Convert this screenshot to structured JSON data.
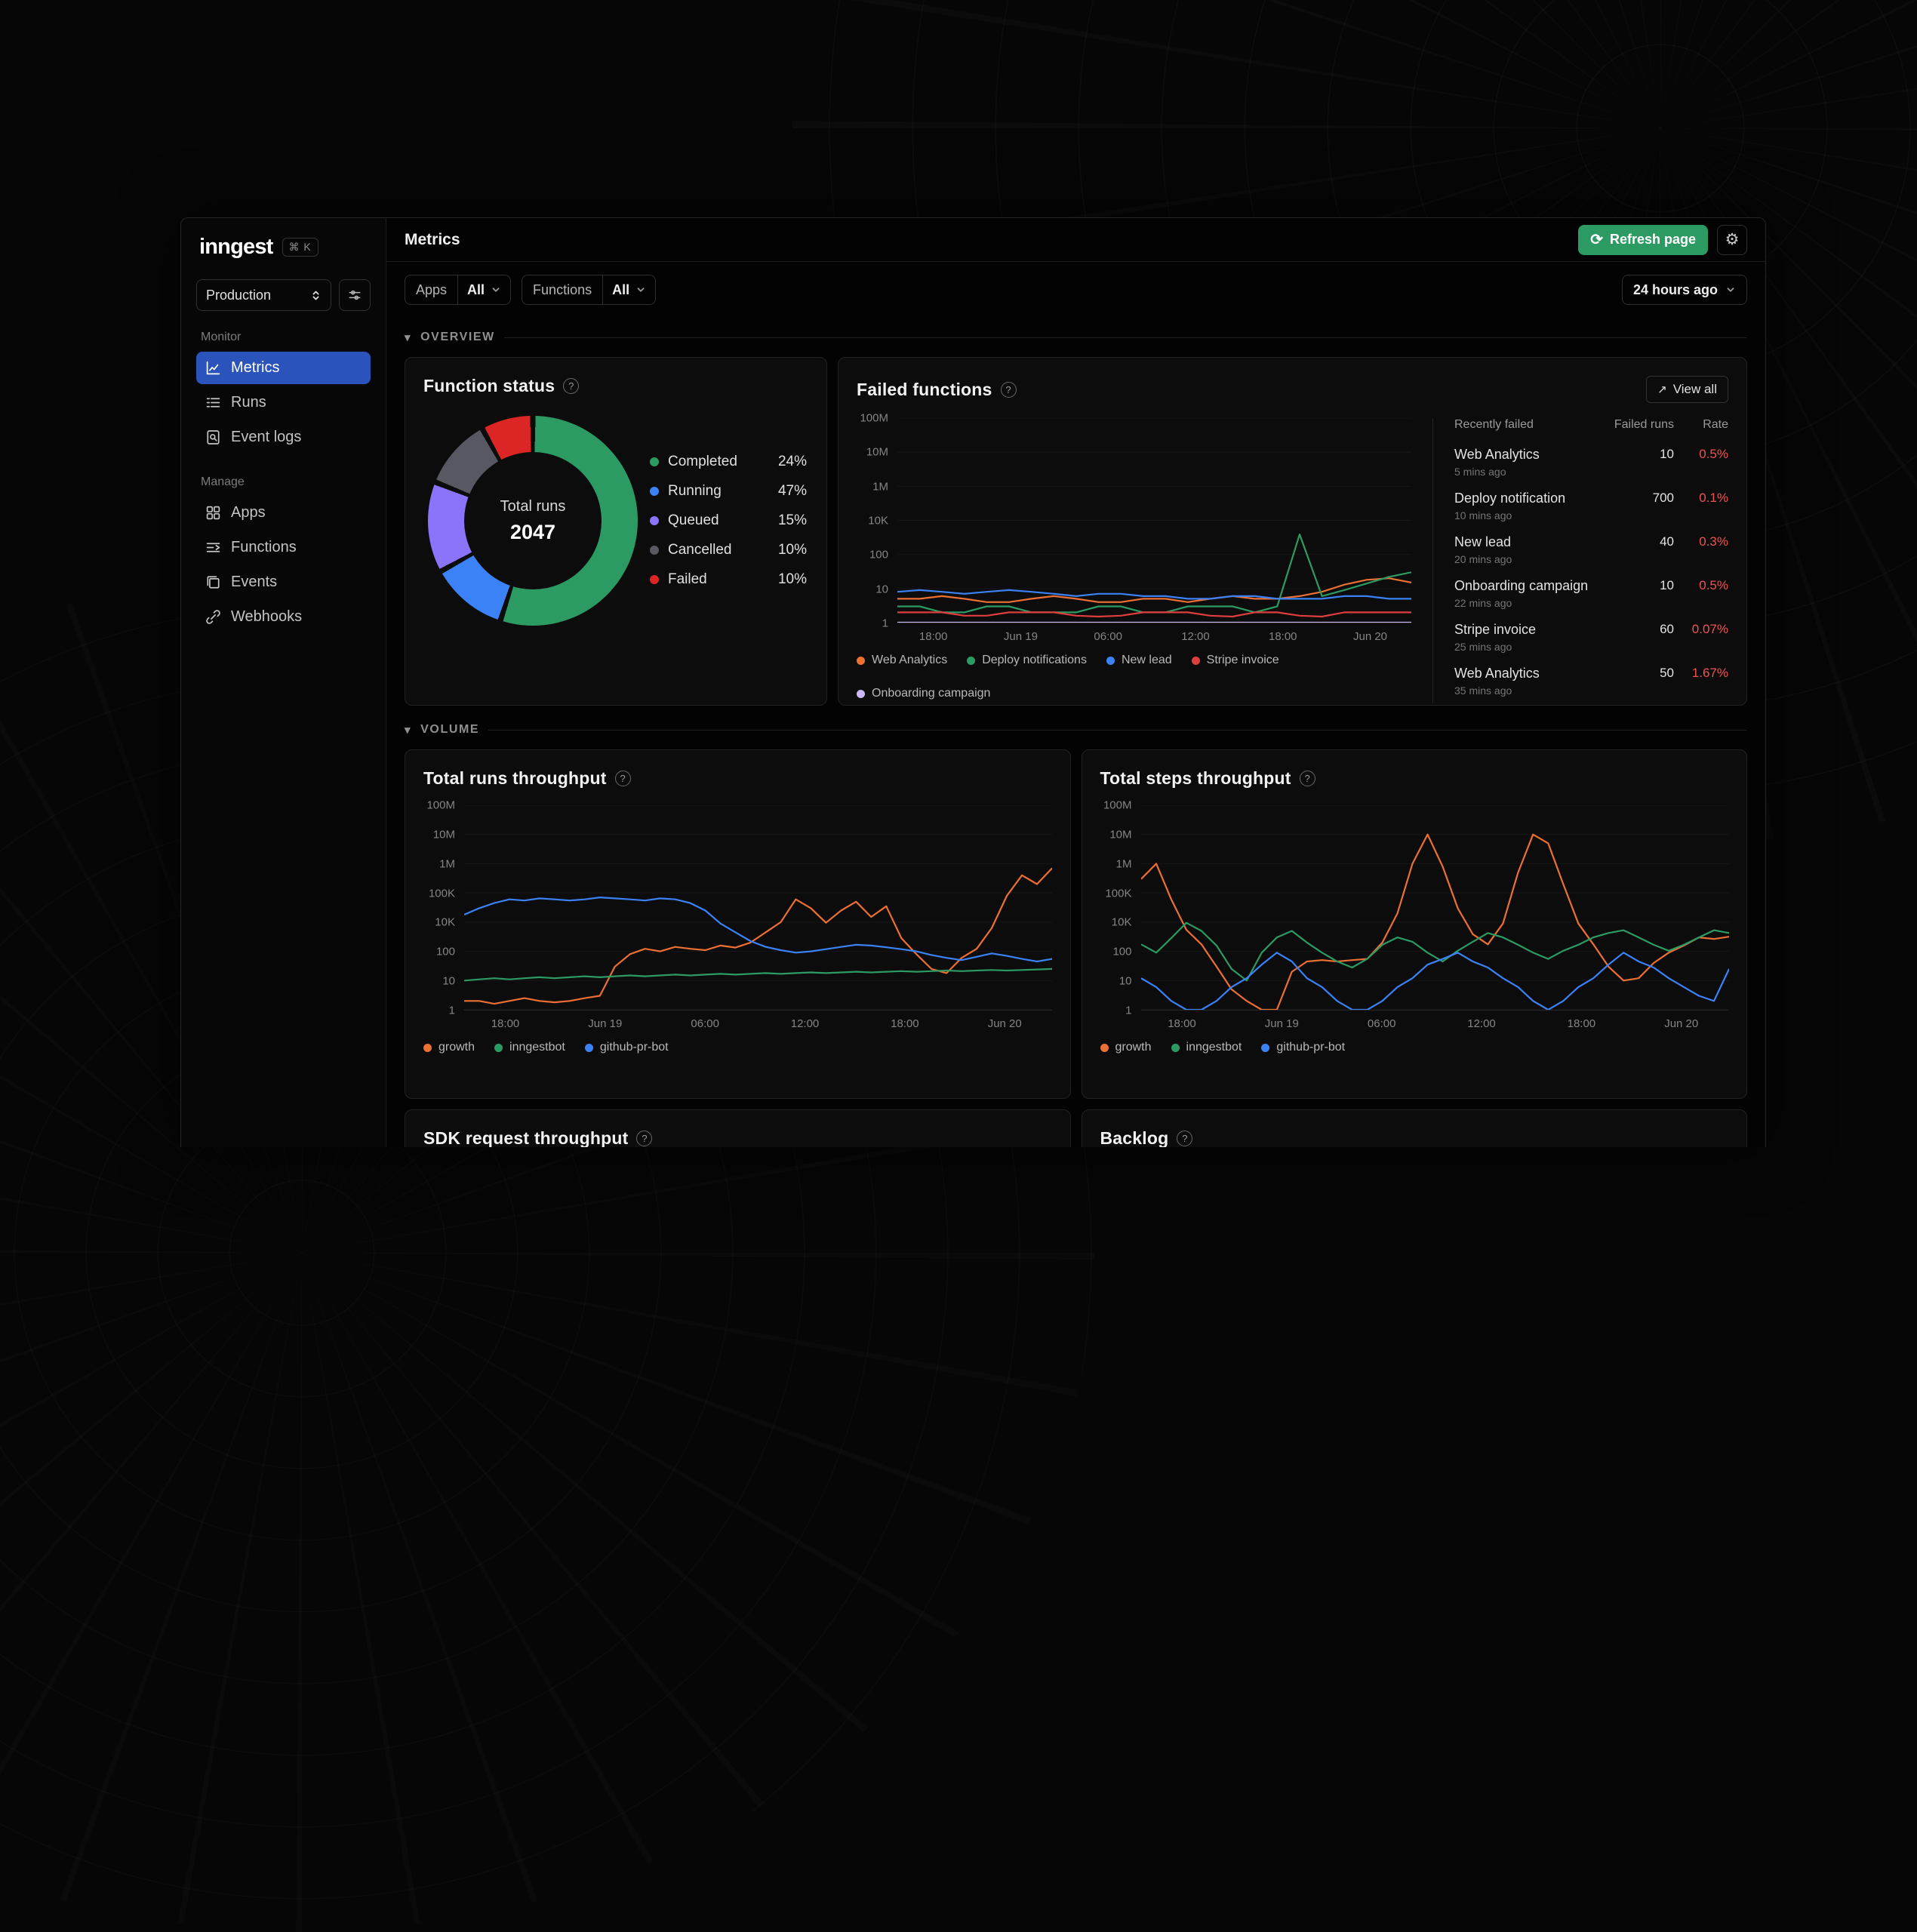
{
  "colors": {
    "brand_green": "#2c9b63",
    "active_nav_blue": "#2a54bb",
    "error_red": "#f05252"
  },
  "sidebar": {
    "logo": "inngest",
    "kbd_shortcut": "⌘ K",
    "env": "Production",
    "monitor_label": "Monitor",
    "manage_label": "Manage",
    "items": {
      "metrics": "Metrics",
      "runs": "Runs",
      "event_logs": "Event logs",
      "apps": "Apps",
      "functions": "Functions",
      "events": "Events",
      "webhooks": "Webhooks"
    }
  },
  "header": {
    "title": "Metrics",
    "refresh_label": "Refresh page"
  },
  "filters": {
    "apps_label": "Apps",
    "apps_value": "All",
    "functions_label": "Functions",
    "functions_value": "All",
    "time_range": "24 hours ago"
  },
  "sections": {
    "overview": "OVERVIEW",
    "volume": "VOLUME"
  },
  "cards": {
    "function_status": {
      "title": "Function status"
    },
    "failed_functions": {
      "title": "Failed functions",
      "view_all": "View all",
      "table": {
        "headers": [
          "Recently failed",
          "Failed runs",
          "Rate"
        ],
        "rows": [
          {
            "name": "Web Analytics",
            "ago": "5 mins ago",
            "runs": "10",
            "rate": "0.5%"
          },
          {
            "name": "Deploy notification",
            "ago": "10 mins ago",
            "runs": "700",
            "rate": "0.1%"
          },
          {
            "name": "New lead",
            "ago": "20 mins ago",
            "runs": "40",
            "rate": "0.3%"
          },
          {
            "name": "Onboarding campaign",
            "ago": "22 mins ago",
            "runs": "10",
            "rate": "0.5%"
          },
          {
            "name": "Stripe invoice",
            "ago": "25 mins ago",
            "runs": "60",
            "rate": "0.07%"
          },
          {
            "name": "Web Analytics",
            "ago": "35 mins ago",
            "runs": "50",
            "rate": "1.67%"
          }
        ]
      }
    },
    "total_runs": {
      "title": "Total runs throughput"
    },
    "total_steps": {
      "title": "Total steps throughput"
    },
    "sdk_requests": {
      "title": "SDK request throughput"
    },
    "backlog": {
      "title": "Backlog"
    }
  },
  "chart_data": [
    {
      "id": "function-status-donut",
      "type": "pie",
      "title": "Function status",
      "center_label": "Total runs",
      "center_value": "2047",
      "slices": [
        {
          "label": "Completed",
          "pct_label": "24%",
          "value_pct": 24,
          "arc_pct": 55,
          "color": "#2c9b63"
        },
        {
          "label": "Running",
          "pct_label": "47%",
          "value_pct": 47,
          "arc_pct": 12,
          "color": "#3b82f6"
        },
        {
          "label": "Queued",
          "pct_label": "15%",
          "value_pct": 15,
          "arc_pct": 14,
          "color": "#8b74f9"
        },
        {
          "label": "Cancelled",
          "pct_label": "10%",
          "value_pct": 10,
          "arc_pct": 11,
          "color": "#585862"
        },
        {
          "label": "Failed",
          "pct_label": "10%",
          "value_pct": 10,
          "arc_pct": 8,
          "color": "#dc2626"
        }
      ]
    },
    {
      "id": "failed-functions-chart",
      "type": "line",
      "title": "Failed functions",
      "y_scale": "log",
      "yticks": [
        1,
        10,
        100,
        10000,
        1000000,
        10000000,
        100000000
      ],
      "ytick_labels": [
        "1",
        "10",
        "100",
        "10K",
        "1M",
        "10M",
        "100M"
      ],
      "xticks": [
        "18:00",
        "Jun 19",
        "06:00",
        "12:00",
        "18:00",
        "Jun 20"
      ],
      "xtick_pos": [
        0.07,
        0.24,
        0.41,
        0.58,
        0.75,
        0.92
      ],
      "legend_position": "bottom",
      "series": [
        {
          "name": "Web Analytics",
          "color": "#ec6f33",
          "values": [
            5,
            5,
            6,
            5,
            4,
            4,
            5,
            6,
            5,
            4,
            4,
            5,
            5,
            4,
            5,
            6,
            5,
            5,
            6,
            8,
            13,
            18,
            20,
            15
          ]
        },
        {
          "name": "Deploy notifications",
          "color": "#2c9b63",
          "values": [
            3,
            3,
            2,
            2,
            3,
            3,
            2,
            2,
            2,
            3,
            3,
            2,
            2,
            3,
            3,
            3,
            2,
            3,
            1500,
            6,
            9,
            14,
            22,
            30
          ]
        },
        {
          "name": "New lead",
          "color": "#3b82f6",
          "values": [
            8,
            9,
            8,
            7,
            8,
            9,
            8,
            7,
            6,
            7,
            7,
            6,
            6,
            5,
            5,
            6,
            6,
            5,
            5,
            5,
            6,
            6,
            5,
            5
          ]
        },
        {
          "name": "Stripe invoice",
          "color": "#e03d3d",
          "values": [
            2,
            2,
            2,
            1.6,
            1.6,
            2,
            2,
            2,
            1.6,
            1.5,
            1.6,
            2,
            2,
            2,
            1.6,
            1.5,
            2,
            2,
            1.6,
            1.5,
            2,
            2,
            2,
            2
          ]
        },
        {
          "name": "Onboarding campaign",
          "color": "#cbb8fc",
          "values": [
            1,
            1,
            1,
            1,
            1,
            1,
            1,
            1,
            1,
            1,
            1,
            1,
            1,
            1,
            1,
            1,
            1,
            1,
            1,
            1,
            1,
            1,
            1,
            1
          ]
        }
      ]
    },
    {
      "id": "total-runs-throughput-chart",
      "type": "line",
      "title": "Total runs throughput",
      "y_scale": "log",
      "yticks": [
        1,
        10,
        100,
        10000,
        100000,
        1000000,
        10000000,
        100000000
      ],
      "ytick_labels": [
        "1",
        "10",
        "100",
        "10K",
        "100K",
        "1M",
        "10M",
        "100M"
      ],
      "xticks": [
        "18:00",
        "Jun 19",
        "06:00",
        "12:00",
        "18:00",
        "Jun 20"
      ],
      "xtick_pos": [
        0.07,
        0.24,
        0.41,
        0.58,
        0.75,
        0.92
      ],
      "legend_position": "bottom",
      "series": [
        {
          "name": "growth",
          "color": "#ec6f33",
          "values": [
            2,
            2,
            1.6,
            2,
            2.5,
            2,
            1.8,
            2,
            2.5,
            3,
            30,
            80,
            150,
            100,
            200,
            150,
            120,
            250,
            180,
            400,
            2000,
            10000,
            60000,
            30000,
            9000,
            25000,
            50000,
            15000,
            35000,
            800,
            80,
            25,
            18,
            60,
            150,
            4000,
            80000,
            400000,
            200000,
            700000
          ]
        },
        {
          "name": "inngestbot",
          "color": "#2c9b63",
          "values": [
            10,
            11,
            12,
            11,
            12,
            13,
            12,
            13,
            14,
            13,
            14,
            15,
            14,
            15,
            16,
            15,
            16,
            17,
            16,
            17,
            18,
            17,
            18,
            19,
            18,
            19,
            20,
            19,
            20,
            21,
            20,
            21,
            22,
            21,
            22,
            23,
            22,
            23,
            24,
            25
          ]
        },
        {
          "name": "github-pr-bot",
          "color": "#3b82f6",
          "values": [
            18000,
            30000,
            45000,
            60000,
            55000,
            65000,
            60000,
            55000,
            60000,
            70000,
            65000,
            60000,
            55000,
            65000,
            60000,
            45000,
            25000,
            8000,
            2000,
            500,
            200,
            120,
            90,
            100,
            140,
            200,
            280,
            250,
            190,
            140,
            100,
            75,
            60,
            50,
            65,
            85,
            70,
            55,
            45,
            55
          ]
        }
      ]
    },
    {
      "id": "total-steps-throughput-chart",
      "type": "line",
      "title": "Total steps throughput",
      "y_scale": "log",
      "yticks": [
        1,
        10,
        100,
        10000,
        100000,
        1000000,
        10000000,
        100000000
      ],
      "ytick_labels": [
        "1",
        "10",
        "100",
        "10K",
        "100K",
        "1M",
        "10M",
        "100M"
      ],
      "xticks": [
        "18:00",
        "Jun 19",
        "06:00",
        "12:00",
        "18:00",
        "Jun 20"
      ],
      "xtick_pos": [
        0.07,
        0.24,
        0.41,
        0.58,
        0.75,
        0.92
      ],
      "legend_position": "bottom",
      "series": [
        {
          "name": "growth",
          "color": "#ec6f33",
          "values": [
            300000,
            1000000,
            60000,
            3000,
            300,
            30,
            5,
            2,
            1,
            1,
            20,
            45,
            50,
            45,
            50,
            55,
            400,
            20000,
            1000000,
            10000000,
            800000,
            30000,
            1500,
            300,
            8000,
            500000,
            10000000,
            5000000,
            200000,
            8000,
            300,
            30,
            10,
            12,
            40,
            90,
            250,
            900,
            700,
            1000
          ]
        },
        {
          "name": "inngestbot",
          "color": "#2c9b63",
          "values": [
            300,
            90,
            800,
            9000,
            2500,
            250,
            25,
            10,
            90,
            900,
            2500,
            400,
            90,
            45,
            28,
            55,
            280,
            900,
            450,
            90,
            45,
            110,
            450,
            1800,
            900,
            280,
            90,
            55,
            110,
            280,
            900,
            1800,
            2800,
            900,
            280,
            110,
            280,
            900,
            2800,
            1800
          ]
        },
        {
          "name": "github-pr-bot",
          "color": "#3b82f6",
          "values": [
            12,
            6,
            2,
            1,
            1,
            2,
            6,
            12,
            35,
            90,
            45,
            12,
            6,
            2,
            1,
            1,
            2,
            6,
            12,
            35,
            55,
            90,
            45,
            28,
            12,
            6,
            2,
            1,
            2,
            6,
            12,
            35,
            90,
            45,
            28,
            12,
            6,
            3,
            2,
            25
          ]
        }
      ]
    }
  ]
}
